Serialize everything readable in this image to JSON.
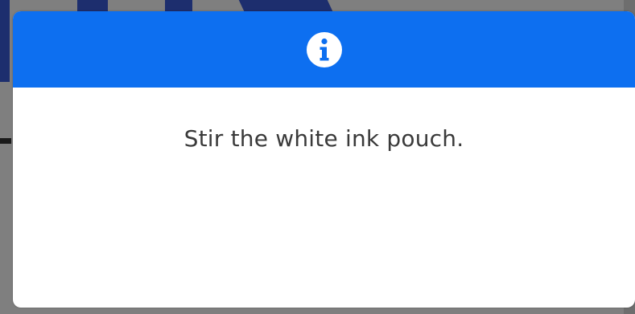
{
  "dialog": {
    "header_icon": "info-icon",
    "header_color": "#0d6ff0",
    "message": "Stir the white ink pouch."
  },
  "backdrop": {
    "dim_color": "#7f7f7f"
  }
}
